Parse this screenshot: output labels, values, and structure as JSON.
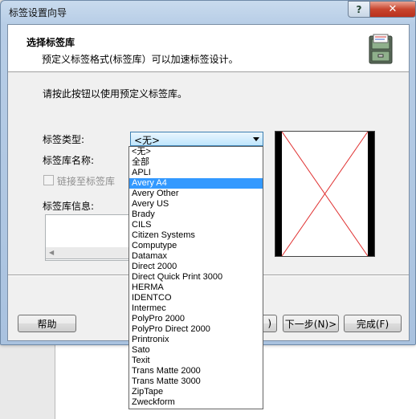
{
  "window": {
    "title": "标签设置向导",
    "help_label": "?",
    "close_label": "✕"
  },
  "header": {
    "title": "选择标签库",
    "subtitle": "预定义标签格式(标签库）可以加速标签设计。",
    "icon": "file-cabinet-icon"
  },
  "body": {
    "instruction": "请按此按钮以使用预定义标签库。",
    "type_label": "标签类型:",
    "type_value": "<无>",
    "library_name_label": "标签库名称:",
    "link_label": "链接至标签库",
    "info_label": "标签库信息:"
  },
  "dropdown": {
    "selected": "Avery A4",
    "options": [
      "<无>",
      "全部",
      "APLI",
      "Avery A4",
      "Avery Other",
      "Avery US",
      "Brady",
      "CILS",
      "Citizen Systems",
      "Computype",
      "Datamax",
      "Direct 2000",
      "Direct Quick Print 3000",
      "HERMA",
      "IDENTCO",
      "Intermec",
      "PolyPro 2000",
      "PolyPro Direct 2000",
      "Printronix",
      "Sato",
      "Texit",
      "Trans Matte 2000",
      "Trans Matte 3000",
      "ZipTape",
      "Zweckform"
    ]
  },
  "buttons": {
    "help": "帮助",
    "back_partial": ")",
    "next": "下一步(N)>",
    "finish": "完成(F)"
  },
  "colors": {
    "selection": "#3399ff",
    "close_button": "#c8452e",
    "preview_cross": "#e03030"
  }
}
